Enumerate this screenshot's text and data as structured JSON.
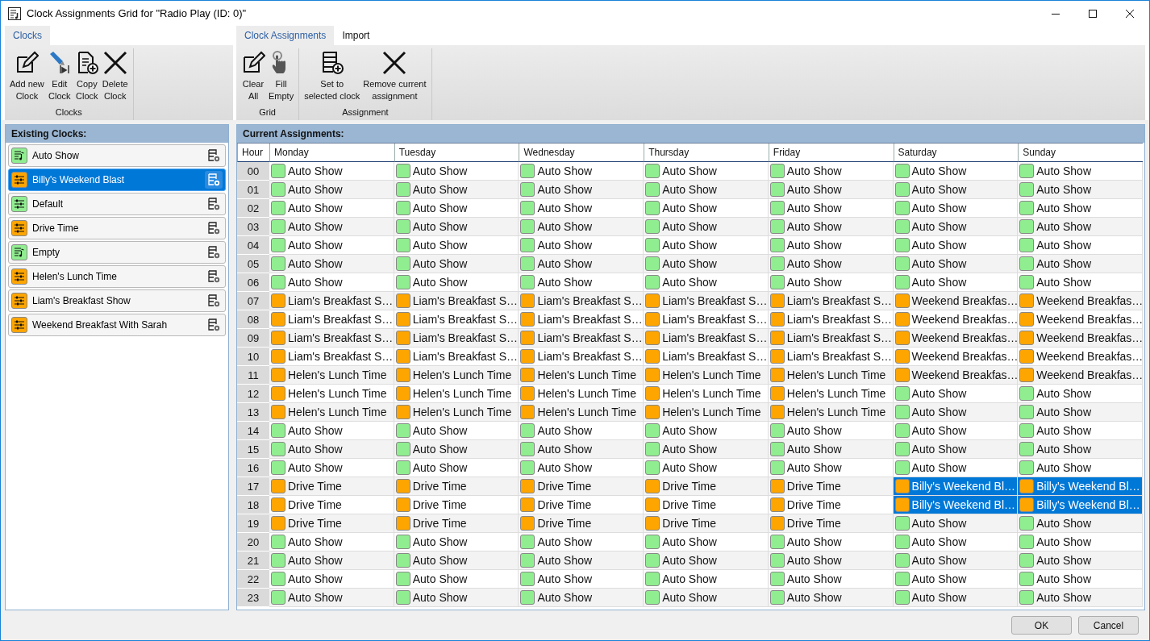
{
  "window": {
    "title": "Clock Assignments Grid for \"Radio Play (ID: 0)\""
  },
  "ribbons": [
    {
      "tabs": [
        {
          "label": "Clocks",
          "selected": true
        }
      ],
      "groups": [
        {
          "label": "Clocks",
          "buttons": [
            {
              "lines": [
                "Add new",
                "Clock"
              ],
              "kind": "edit"
            },
            {
              "lines": [
                "Edit",
                "Clock"
              ],
              "kind": "pen"
            },
            {
              "lines": [
                "Copy",
                "Clock"
              ],
              "kind": "copy"
            },
            {
              "lines": [
                "Delete",
                "Clock"
              ],
              "kind": "delete"
            }
          ]
        }
      ]
    },
    {
      "tabs": [
        {
          "label": "Clock Assignments",
          "selected": true
        },
        {
          "label": "Import",
          "selected": false
        }
      ],
      "groups": [
        {
          "label": "Grid",
          "buttons": [
            {
              "lines": [
                "Clear",
                "All"
              ],
              "kind": "edit"
            },
            {
              "lines": [
                "Fill",
                "Empty"
              ],
              "kind": "hand"
            }
          ]
        },
        {
          "label": "Assignment",
          "buttons": [
            {
              "lines": [
                "Set to",
                "selected clock"
              ],
              "kind": "add"
            },
            {
              "lines": [
                "Remove current",
                "assignment"
              ],
              "kind": "delete"
            }
          ]
        }
      ]
    }
  ],
  "sidebar": {
    "title": "Existing Clocks:",
    "items": [
      {
        "name": "Auto Show",
        "kind": "playlist",
        "color": "#90ee90",
        "selected": false
      },
      {
        "name": "Billy's Weekend Blast",
        "kind": "mixer",
        "color": "#ffa500",
        "selected": true
      },
      {
        "name": "Default",
        "kind": "mixer",
        "color": "#90ee90",
        "selected": false
      },
      {
        "name": "Drive Time",
        "kind": "mixer",
        "color": "#ffa500",
        "selected": false
      },
      {
        "name": "Empty",
        "kind": "playlist",
        "color": "#90ee90",
        "selected": false
      },
      {
        "name": "Helen's Lunch Time",
        "kind": "mixer",
        "color": "#ffa500",
        "selected": false
      },
      {
        "name": "Liam's Breakfast Show",
        "kind": "mixer",
        "color": "#ffa500",
        "selected": false
      },
      {
        "name": "Weekend Breakfast With Sarah",
        "kind": "mixer",
        "color": "#ffa500",
        "selected": false
      }
    ]
  },
  "grid": {
    "title": "Current Assignments:",
    "columns": [
      "Hour",
      "Monday",
      "Tuesday",
      "Wednesday",
      "Thursday",
      "Friday",
      "Saturday",
      "Sunday"
    ],
    "rows": [
      {
        "cells": [
          {
            "kind": "hour",
            "text": "00"
          },
          {
            "kind": "clock",
            "text": "Auto Show",
            "color": "#90ee90",
            "selected": false
          },
          {
            "kind": "clock",
            "text": "Auto Show",
            "color": "#90ee90",
            "selected": false
          },
          {
            "kind": "clock",
            "text": "Auto Show",
            "color": "#90ee90",
            "selected": false
          },
          {
            "kind": "clock",
            "text": "Auto Show",
            "color": "#90ee90",
            "selected": false
          },
          {
            "kind": "clock",
            "text": "Auto Show",
            "color": "#90ee90",
            "selected": false
          },
          {
            "kind": "clock",
            "text": "Auto Show",
            "color": "#90ee90",
            "selected": false
          },
          {
            "kind": "clock",
            "text": "Auto Show",
            "color": "#90ee90",
            "selected": false
          }
        ]
      },
      {
        "cells": [
          {
            "kind": "hour",
            "text": "01"
          },
          {
            "kind": "clock",
            "text": "Auto Show",
            "color": "#90ee90",
            "selected": false
          },
          {
            "kind": "clock",
            "text": "Auto Show",
            "color": "#90ee90",
            "selected": false
          },
          {
            "kind": "clock",
            "text": "Auto Show",
            "color": "#90ee90",
            "selected": false
          },
          {
            "kind": "clock",
            "text": "Auto Show",
            "color": "#90ee90",
            "selected": false
          },
          {
            "kind": "clock",
            "text": "Auto Show",
            "color": "#90ee90",
            "selected": false
          },
          {
            "kind": "clock",
            "text": "Auto Show",
            "color": "#90ee90",
            "selected": false
          },
          {
            "kind": "clock",
            "text": "Auto Show",
            "color": "#90ee90",
            "selected": false
          }
        ]
      },
      {
        "cells": [
          {
            "kind": "hour",
            "text": "02"
          },
          {
            "kind": "clock",
            "text": "Auto Show",
            "color": "#90ee90",
            "selected": false
          },
          {
            "kind": "clock",
            "text": "Auto Show",
            "color": "#90ee90",
            "selected": false
          },
          {
            "kind": "clock",
            "text": "Auto Show",
            "color": "#90ee90",
            "selected": false
          },
          {
            "kind": "clock",
            "text": "Auto Show",
            "color": "#90ee90",
            "selected": false
          },
          {
            "kind": "clock",
            "text": "Auto Show",
            "color": "#90ee90",
            "selected": false
          },
          {
            "kind": "clock",
            "text": "Auto Show",
            "color": "#90ee90",
            "selected": false
          },
          {
            "kind": "clock",
            "text": "Auto Show",
            "color": "#90ee90",
            "selected": false
          }
        ]
      },
      {
        "cells": [
          {
            "kind": "hour",
            "text": "03"
          },
          {
            "kind": "clock",
            "text": "Auto Show",
            "color": "#90ee90",
            "selected": false
          },
          {
            "kind": "clock",
            "text": "Auto Show",
            "color": "#90ee90",
            "selected": false
          },
          {
            "kind": "clock",
            "text": "Auto Show",
            "color": "#90ee90",
            "selected": false
          },
          {
            "kind": "clock",
            "text": "Auto Show",
            "color": "#90ee90",
            "selected": false
          },
          {
            "kind": "clock",
            "text": "Auto Show",
            "color": "#90ee90",
            "selected": false
          },
          {
            "kind": "clock",
            "text": "Auto Show",
            "color": "#90ee90",
            "selected": false
          },
          {
            "kind": "clock",
            "text": "Auto Show",
            "color": "#90ee90",
            "selected": false
          }
        ]
      },
      {
        "cells": [
          {
            "kind": "hour",
            "text": "04"
          },
          {
            "kind": "clock",
            "text": "Auto Show",
            "color": "#90ee90",
            "selected": false
          },
          {
            "kind": "clock",
            "text": "Auto Show",
            "color": "#90ee90",
            "selected": false
          },
          {
            "kind": "clock",
            "text": "Auto Show",
            "color": "#90ee90",
            "selected": false
          },
          {
            "kind": "clock",
            "text": "Auto Show",
            "color": "#90ee90",
            "selected": false
          },
          {
            "kind": "clock",
            "text": "Auto Show",
            "color": "#90ee90",
            "selected": false
          },
          {
            "kind": "clock",
            "text": "Auto Show",
            "color": "#90ee90",
            "selected": false
          },
          {
            "kind": "clock",
            "text": "Auto Show",
            "color": "#90ee90",
            "selected": false
          }
        ]
      },
      {
        "cells": [
          {
            "kind": "hour",
            "text": "05"
          },
          {
            "kind": "clock",
            "text": "Auto Show",
            "color": "#90ee90",
            "selected": false
          },
          {
            "kind": "clock",
            "text": "Auto Show",
            "color": "#90ee90",
            "selected": false
          },
          {
            "kind": "clock",
            "text": "Auto Show",
            "color": "#90ee90",
            "selected": false
          },
          {
            "kind": "clock",
            "text": "Auto Show",
            "color": "#90ee90",
            "selected": false
          },
          {
            "kind": "clock",
            "text": "Auto Show",
            "color": "#90ee90",
            "selected": false
          },
          {
            "kind": "clock",
            "text": "Auto Show",
            "color": "#90ee90",
            "selected": false
          },
          {
            "kind": "clock",
            "text": "Auto Show",
            "color": "#90ee90",
            "selected": false
          }
        ]
      },
      {
        "cells": [
          {
            "kind": "hour",
            "text": "06"
          },
          {
            "kind": "clock",
            "text": "Auto Show",
            "color": "#90ee90",
            "selected": false
          },
          {
            "kind": "clock",
            "text": "Auto Show",
            "color": "#90ee90",
            "selected": false
          },
          {
            "kind": "clock",
            "text": "Auto Show",
            "color": "#90ee90",
            "selected": false
          },
          {
            "kind": "clock",
            "text": "Auto Show",
            "color": "#90ee90",
            "selected": false
          },
          {
            "kind": "clock",
            "text": "Auto Show",
            "color": "#90ee90",
            "selected": false
          },
          {
            "kind": "clock",
            "text": "Auto Show",
            "color": "#90ee90",
            "selected": false
          },
          {
            "kind": "clock",
            "text": "Auto Show",
            "color": "#90ee90",
            "selected": false
          }
        ]
      },
      {
        "cells": [
          {
            "kind": "hour",
            "text": "07"
          },
          {
            "kind": "clock",
            "text": "Liam's Breakfast S…",
            "color": "#ffa500",
            "selected": false
          },
          {
            "kind": "clock",
            "text": "Liam's Breakfast S…",
            "color": "#ffa500",
            "selected": false
          },
          {
            "kind": "clock",
            "text": "Liam's Breakfast S…",
            "color": "#ffa500",
            "selected": false
          },
          {
            "kind": "clock",
            "text": "Liam's Breakfast S…",
            "color": "#ffa500",
            "selected": false
          },
          {
            "kind": "clock",
            "text": "Liam's Breakfast S…",
            "color": "#ffa500",
            "selected": false
          },
          {
            "kind": "clock",
            "text": "Weekend Breakfas…",
            "color": "#ffa500",
            "selected": false
          },
          {
            "kind": "clock",
            "text": "Weekend Breakfas…",
            "color": "#ffa500",
            "selected": false
          }
        ]
      },
      {
        "cells": [
          {
            "kind": "hour",
            "text": "08"
          },
          {
            "kind": "clock",
            "text": "Liam's Breakfast S…",
            "color": "#ffa500",
            "selected": false
          },
          {
            "kind": "clock",
            "text": "Liam's Breakfast S…",
            "color": "#ffa500",
            "selected": false
          },
          {
            "kind": "clock",
            "text": "Liam's Breakfast S…",
            "color": "#ffa500",
            "selected": false
          },
          {
            "kind": "clock",
            "text": "Liam's Breakfast S…",
            "color": "#ffa500",
            "selected": false
          },
          {
            "kind": "clock",
            "text": "Liam's Breakfast S…",
            "color": "#ffa500",
            "selected": false
          },
          {
            "kind": "clock",
            "text": "Weekend Breakfas…",
            "color": "#ffa500",
            "selected": false
          },
          {
            "kind": "clock",
            "text": "Weekend Breakfas…",
            "color": "#ffa500",
            "selected": false
          }
        ]
      },
      {
        "cells": [
          {
            "kind": "hour",
            "text": "09"
          },
          {
            "kind": "clock",
            "text": "Liam's Breakfast S…",
            "color": "#ffa500",
            "selected": false
          },
          {
            "kind": "clock",
            "text": "Liam's Breakfast S…",
            "color": "#ffa500",
            "selected": false
          },
          {
            "kind": "clock",
            "text": "Liam's Breakfast S…",
            "color": "#ffa500",
            "selected": false
          },
          {
            "kind": "clock",
            "text": "Liam's Breakfast S…",
            "color": "#ffa500",
            "selected": false
          },
          {
            "kind": "clock",
            "text": "Liam's Breakfast S…",
            "color": "#ffa500",
            "selected": false
          },
          {
            "kind": "clock",
            "text": "Weekend Breakfas…",
            "color": "#ffa500",
            "selected": false
          },
          {
            "kind": "clock",
            "text": "Weekend Breakfas…",
            "color": "#ffa500",
            "selected": false
          }
        ]
      },
      {
        "cells": [
          {
            "kind": "hour",
            "text": "10"
          },
          {
            "kind": "clock",
            "text": "Liam's Breakfast S…",
            "color": "#ffa500",
            "selected": false
          },
          {
            "kind": "clock",
            "text": "Liam's Breakfast S…",
            "color": "#ffa500",
            "selected": false
          },
          {
            "kind": "clock",
            "text": "Liam's Breakfast S…",
            "color": "#ffa500",
            "selected": false
          },
          {
            "kind": "clock",
            "text": "Liam's Breakfast S…",
            "color": "#ffa500",
            "selected": false
          },
          {
            "kind": "clock",
            "text": "Liam's Breakfast S…",
            "color": "#ffa500",
            "selected": false
          },
          {
            "kind": "clock",
            "text": "Weekend Breakfas…",
            "color": "#ffa500",
            "selected": false
          },
          {
            "kind": "clock",
            "text": "Weekend Breakfas…",
            "color": "#ffa500",
            "selected": false
          }
        ]
      },
      {
        "cells": [
          {
            "kind": "hour",
            "text": "11"
          },
          {
            "kind": "clock",
            "text": "Helen's Lunch Time",
            "color": "#ffa500",
            "selected": false
          },
          {
            "kind": "clock",
            "text": "Helen's Lunch Time",
            "color": "#ffa500",
            "selected": false
          },
          {
            "kind": "clock",
            "text": "Helen's Lunch Time",
            "color": "#ffa500",
            "selected": false
          },
          {
            "kind": "clock",
            "text": "Helen's Lunch Time",
            "color": "#ffa500",
            "selected": false
          },
          {
            "kind": "clock",
            "text": "Helen's Lunch Time",
            "color": "#ffa500",
            "selected": false
          },
          {
            "kind": "clock",
            "text": "Weekend Breakfas…",
            "color": "#ffa500",
            "selected": false
          },
          {
            "kind": "clock",
            "text": "Weekend Breakfas…",
            "color": "#ffa500",
            "selected": false
          }
        ]
      },
      {
        "cells": [
          {
            "kind": "hour",
            "text": "12"
          },
          {
            "kind": "clock",
            "text": "Helen's Lunch Time",
            "color": "#ffa500",
            "selected": false
          },
          {
            "kind": "clock",
            "text": "Helen's Lunch Time",
            "color": "#ffa500",
            "selected": false
          },
          {
            "kind": "clock",
            "text": "Helen's Lunch Time",
            "color": "#ffa500",
            "selected": false
          },
          {
            "kind": "clock",
            "text": "Helen's Lunch Time",
            "color": "#ffa500",
            "selected": false
          },
          {
            "kind": "clock",
            "text": "Helen's Lunch Time",
            "color": "#ffa500",
            "selected": false
          },
          {
            "kind": "clock",
            "text": "Auto Show",
            "color": "#90ee90",
            "selected": false
          },
          {
            "kind": "clock",
            "text": "Auto Show",
            "color": "#90ee90",
            "selected": false
          }
        ]
      },
      {
        "cells": [
          {
            "kind": "hour",
            "text": "13"
          },
          {
            "kind": "clock",
            "text": "Helen's Lunch Time",
            "color": "#ffa500",
            "selected": false
          },
          {
            "kind": "clock",
            "text": "Helen's Lunch Time",
            "color": "#ffa500",
            "selected": false
          },
          {
            "kind": "clock",
            "text": "Helen's Lunch Time",
            "color": "#ffa500",
            "selected": false
          },
          {
            "kind": "clock",
            "text": "Helen's Lunch Time",
            "color": "#ffa500",
            "selected": false
          },
          {
            "kind": "clock",
            "text": "Helen's Lunch Time",
            "color": "#ffa500",
            "selected": false
          },
          {
            "kind": "clock",
            "text": "Auto Show",
            "color": "#90ee90",
            "selected": false
          },
          {
            "kind": "clock",
            "text": "Auto Show",
            "color": "#90ee90",
            "selected": false
          }
        ]
      },
      {
        "cells": [
          {
            "kind": "hour",
            "text": "14"
          },
          {
            "kind": "clock",
            "text": "Auto Show",
            "color": "#90ee90",
            "selected": false
          },
          {
            "kind": "clock",
            "text": "Auto Show",
            "color": "#90ee90",
            "selected": false
          },
          {
            "kind": "clock",
            "text": "Auto Show",
            "color": "#90ee90",
            "selected": false
          },
          {
            "kind": "clock",
            "text": "Auto Show",
            "color": "#90ee90",
            "selected": false
          },
          {
            "kind": "clock",
            "text": "Auto Show",
            "color": "#90ee90",
            "selected": false
          },
          {
            "kind": "clock",
            "text": "Auto Show",
            "color": "#90ee90",
            "selected": false
          },
          {
            "kind": "clock",
            "text": "Auto Show",
            "color": "#90ee90",
            "selected": false
          }
        ]
      },
      {
        "cells": [
          {
            "kind": "hour",
            "text": "15"
          },
          {
            "kind": "clock",
            "text": "Auto Show",
            "color": "#90ee90",
            "selected": false
          },
          {
            "kind": "clock",
            "text": "Auto Show",
            "color": "#90ee90",
            "selected": false
          },
          {
            "kind": "clock",
            "text": "Auto Show",
            "color": "#90ee90",
            "selected": false
          },
          {
            "kind": "clock",
            "text": "Auto Show",
            "color": "#90ee90",
            "selected": false
          },
          {
            "kind": "clock",
            "text": "Auto Show",
            "color": "#90ee90",
            "selected": false
          },
          {
            "kind": "clock",
            "text": "Auto Show",
            "color": "#90ee90",
            "selected": false
          },
          {
            "kind": "clock",
            "text": "Auto Show",
            "color": "#90ee90",
            "selected": false
          }
        ]
      },
      {
        "cells": [
          {
            "kind": "hour",
            "text": "16"
          },
          {
            "kind": "clock",
            "text": "Auto Show",
            "color": "#90ee90",
            "selected": false
          },
          {
            "kind": "clock",
            "text": "Auto Show",
            "color": "#90ee90",
            "selected": false
          },
          {
            "kind": "clock",
            "text": "Auto Show",
            "color": "#90ee90",
            "selected": false
          },
          {
            "kind": "clock",
            "text": "Auto Show",
            "color": "#90ee90",
            "selected": false
          },
          {
            "kind": "clock",
            "text": "Auto Show",
            "color": "#90ee90",
            "selected": false
          },
          {
            "kind": "clock",
            "text": "Auto Show",
            "color": "#90ee90",
            "selected": false
          },
          {
            "kind": "clock",
            "text": "Auto Show",
            "color": "#90ee90",
            "selected": false
          }
        ]
      },
      {
        "cells": [
          {
            "kind": "hour",
            "text": "17"
          },
          {
            "kind": "clock",
            "text": "Drive Time",
            "color": "#ffa500",
            "selected": false
          },
          {
            "kind": "clock",
            "text": "Drive Time",
            "color": "#ffa500",
            "selected": false
          },
          {
            "kind": "clock",
            "text": "Drive Time",
            "color": "#ffa500",
            "selected": false
          },
          {
            "kind": "clock",
            "text": "Drive Time",
            "color": "#ffa500",
            "selected": false
          },
          {
            "kind": "clock",
            "text": "Drive Time",
            "color": "#ffa500",
            "selected": false
          },
          {
            "kind": "clock",
            "text": "Billy's Weekend Bl…",
            "color": "#ffa500",
            "selected": true
          },
          {
            "kind": "clock",
            "text": "Billy's Weekend Bl…",
            "color": "#ffa500",
            "selected": true
          }
        ]
      },
      {
        "cells": [
          {
            "kind": "hour",
            "text": "18"
          },
          {
            "kind": "clock",
            "text": "Drive Time",
            "color": "#ffa500",
            "selected": false
          },
          {
            "kind": "clock",
            "text": "Drive Time",
            "color": "#ffa500",
            "selected": false
          },
          {
            "kind": "clock",
            "text": "Drive Time",
            "color": "#ffa500",
            "selected": false
          },
          {
            "kind": "clock",
            "text": "Drive Time",
            "color": "#ffa500",
            "selected": false
          },
          {
            "kind": "clock",
            "text": "Drive Time",
            "color": "#ffa500",
            "selected": false
          },
          {
            "kind": "clock",
            "text": "Billy's Weekend Bl…",
            "color": "#ffa500",
            "selected": true
          },
          {
            "kind": "clock",
            "text": "Billy's Weekend Bl…",
            "color": "#ffa500",
            "selected": true
          }
        ]
      },
      {
        "cells": [
          {
            "kind": "hour",
            "text": "19"
          },
          {
            "kind": "clock",
            "text": "Drive Time",
            "color": "#ffa500",
            "selected": false
          },
          {
            "kind": "clock",
            "text": "Drive Time",
            "color": "#ffa500",
            "selected": false
          },
          {
            "kind": "clock",
            "text": "Drive Time",
            "color": "#ffa500",
            "selected": false
          },
          {
            "kind": "clock",
            "text": "Drive Time",
            "color": "#ffa500",
            "selected": false
          },
          {
            "kind": "clock",
            "text": "Drive Time",
            "color": "#ffa500",
            "selected": false
          },
          {
            "kind": "clock",
            "text": "Auto Show",
            "color": "#90ee90",
            "selected": false
          },
          {
            "kind": "clock",
            "text": "Auto Show",
            "color": "#90ee90",
            "selected": false
          }
        ]
      },
      {
        "cells": [
          {
            "kind": "hour",
            "text": "20"
          },
          {
            "kind": "clock",
            "text": "Auto Show",
            "color": "#90ee90",
            "selected": false
          },
          {
            "kind": "clock",
            "text": "Auto Show",
            "color": "#90ee90",
            "selected": false
          },
          {
            "kind": "clock",
            "text": "Auto Show",
            "color": "#90ee90",
            "selected": false
          },
          {
            "kind": "clock",
            "text": "Auto Show",
            "color": "#90ee90",
            "selected": false
          },
          {
            "kind": "clock",
            "text": "Auto Show",
            "color": "#90ee90",
            "selected": false
          },
          {
            "kind": "clock",
            "text": "Auto Show",
            "color": "#90ee90",
            "selected": false
          },
          {
            "kind": "clock",
            "text": "Auto Show",
            "color": "#90ee90",
            "selected": false
          }
        ]
      },
      {
        "cells": [
          {
            "kind": "hour",
            "text": "21"
          },
          {
            "kind": "clock",
            "text": "Auto Show",
            "color": "#90ee90",
            "selected": false
          },
          {
            "kind": "clock",
            "text": "Auto Show",
            "color": "#90ee90",
            "selected": false
          },
          {
            "kind": "clock",
            "text": "Auto Show",
            "color": "#90ee90",
            "selected": false
          },
          {
            "kind": "clock",
            "text": "Auto Show",
            "color": "#90ee90",
            "selected": false
          },
          {
            "kind": "clock",
            "text": "Auto Show",
            "color": "#90ee90",
            "selected": false
          },
          {
            "kind": "clock",
            "text": "Auto Show",
            "color": "#90ee90",
            "selected": false
          },
          {
            "kind": "clock",
            "text": "Auto Show",
            "color": "#90ee90",
            "selected": false
          }
        ]
      },
      {
        "cells": [
          {
            "kind": "hour",
            "text": "22"
          },
          {
            "kind": "clock",
            "text": "Auto Show",
            "color": "#90ee90",
            "selected": false
          },
          {
            "kind": "clock",
            "text": "Auto Show",
            "color": "#90ee90",
            "selected": false
          },
          {
            "kind": "clock",
            "text": "Auto Show",
            "color": "#90ee90",
            "selected": false
          },
          {
            "kind": "clock",
            "text": "Auto Show",
            "color": "#90ee90",
            "selected": false
          },
          {
            "kind": "clock",
            "text": "Auto Show",
            "color": "#90ee90",
            "selected": false
          },
          {
            "kind": "clock",
            "text": "Auto Show",
            "color": "#90ee90",
            "selected": false
          },
          {
            "kind": "clock",
            "text": "Auto Show",
            "color": "#90ee90",
            "selected": false
          }
        ]
      },
      {
        "cells": [
          {
            "kind": "hour",
            "text": "23"
          },
          {
            "kind": "clock",
            "text": "Auto Show",
            "color": "#90ee90",
            "selected": false
          },
          {
            "kind": "clock",
            "text": "Auto Show",
            "color": "#90ee90",
            "selected": false
          },
          {
            "kind": "clock",
            "text": "Auto Show",
            "color": "#90ee90",
            "selected": false
          },
          {
            "kind": "clock",
            "text": "Auto Show",
            "color": "#90ee90",
            "selected": false
          },
          {
            "kind": "clock",
            "text": "Auto Show",
            "color": "#90ee90",
            "selected": false
          },
          {
            "kind": "clock",
            "text": "Auto Show",
            "color": "#90ee90",
            "selected": false
          },
          {
            "kind": "clock",
            "text": "Auto Show",
            "color": "#90ee90",
            "selected": false
          }
        ]
      }
    ]
  },
  "buttons": [
    "OK",
    "Cancel"
  ]
}
